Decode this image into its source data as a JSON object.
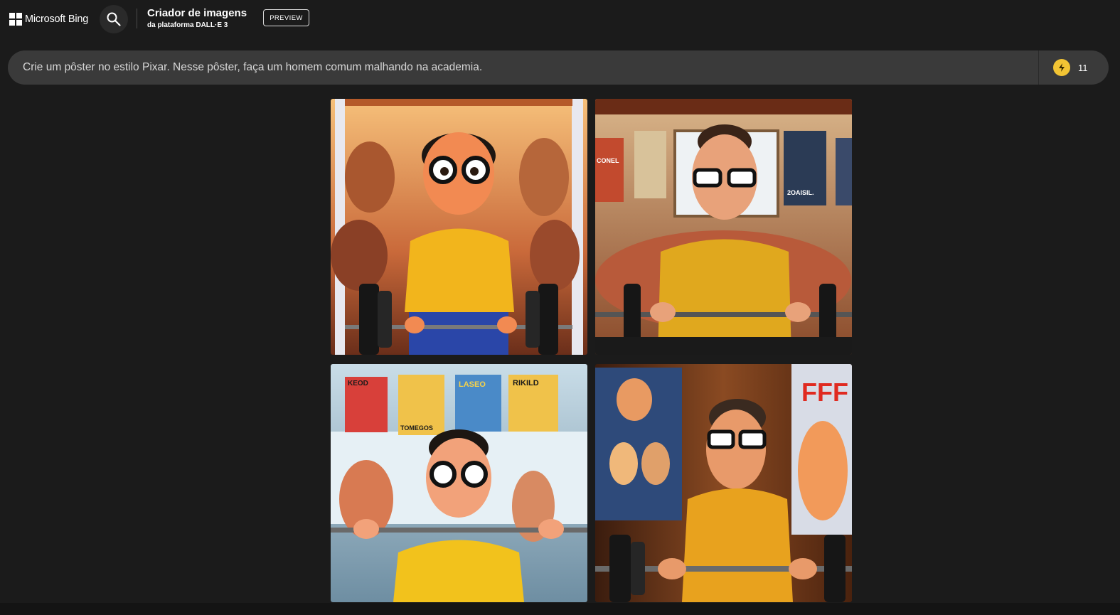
{
  "header": {
    "brand": "Microsoft Bing",
    "title": "Criador de imagens",
    "subtitle": "da plataforma DALL·E 3",
    "badge": "PREVIEW"
  },
  "prompt": {
    "value": "Crie um pôster no estilo Pixar. Nesse pôster, faça um homem comum malhando na academia."
  },
  "boosts": {
    "count": "11"
  },
  "icons": {
    "logo": "microsoft-logo-icon",
    "search": "search-icon",
    "boost": "lightning-bolt-icon"
  },
  "images": [
    {
      "poster_text": ""
    },
    {
      "poster_text": "CONEL",
      "poster_text_2": "2OAISIL."
    },
    {
      "poster_text": "KEOD",
      "poster_text_2": "LASEO",
      "poster_text_3": "RIKILD",
      "poster_text_4": "TOMEGOS"
    },
    {
      "poster_text": "FFF"
    }
  ],
  "colors": {
    "background": "#1b1b1b",
    "prompt_bar": "#3a3a3a",
    "boost_icon": "#f2c434",
    "shirt_yellow": "#f2b51c"
  }
}
